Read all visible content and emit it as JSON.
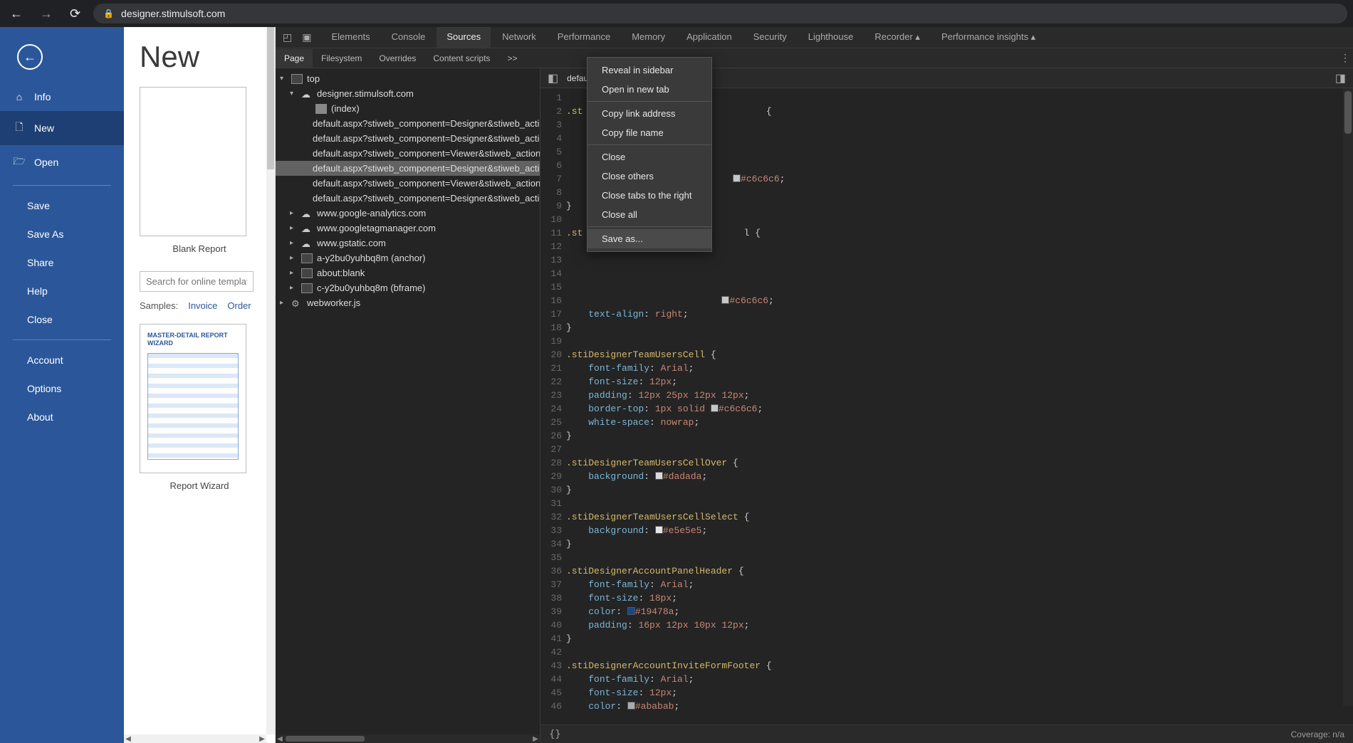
{
  "browser": {
    "url": "designer.stimulsoft.com"
  },
  "app_sidebar": {
    "items": [
      {
        "icon": "ⓘ",
        "label": "Info"
      },
      {
        "icon": "🗋",
        "label": "New"
      },
      {
        "icon": "🗁",
        "label": "Open"
      }
    ],
    "sub1": [
      "Save",
      "Save As",
      "Share",
      "Help",
      "Close"
    ],
    "sub2": [
      "Account",
      "Options",
      "About"
    ]
  },
  "app_content": {
    "title": "New",
    "blank": "Blank Report",
    "search_placeholder": "Search for online templates",
    "samples_label": "Samples:",
    "sample_links": [
      "Invoice",
      "Order"
    ],
    "wizard_title": "MASTER-DETAIL REPORT WIZARD",
    "wizard_label": "Report Wizard"
  },
  "devtools": {
    "top_tabs": [
      "Elements",
      "Console",
      "Sources",
      "Network",
      "Performance",
      "Memory",
      "Application",
      "Security",
      "Lighthouse",
      "Recorder ▴",
      "Performance insights ▴"
    ],
    "top_active": "Sources",
    "sub_tabs": [
      "Page",
      "Filesystem",
      "Overrides",
      "Content scripts",
      ">>"
    ],
    "sub_active": "Page",
    "tree": [
      {
        "indent": 0,
        "toggle": "▾",
        "icon": "frame",
        "label": "top"
      },
      {
        "indent": 1,
        "toggle": "▾",
        "icon": "cloud",
        "label": "designer.stimulsoft.com"
      },
      {
        "indent": 2,
        "toggle": "",
        "icon": "doc",
        "label": "(index)"
      },
      {
        "indent": 2,
        "toggle": "",
        "icon": "yellow",
        "label": "default.aspx?stiweb_component=Designer&stiweb_action=..."
      },
      {
        "indent": 2,
        "toggle": "",
        "icon": "yellow",
        "label": "default.aspx?stiweb_component=Designer&stiweb_action=..."
      },
      {
        "indent": 2,
        "toggle": "",
        "icon": "yellow",
        "label": "default.aspx?stiweb_component=Viewer&stiweb_action=..."
      },
      {
        "indent": 2,
        "toggle": "",
        "icon": "purple",
        "label": "default.aspx?stiweb_component=Designer&stiweb_action=...",
        "hl": true
      },
      {
        "indent": 2,
        "toggle": "",
        "icon": "purple",
        "label": "default.aspx?stiweb_component=Viewer&stiweb_action=..."
      },
      {
        "indent": 2,
        "toggle": "",
        "icon": "green",
        "label": "default.aspx?stiweb_component=Designer&stiweb_action=..."
      },
      {
        "indent": 1,
        "toggle": "▸",
        "icon": "cloud",
        "label": "www.google-analytics.com"
      },
      {
        "indent": 1,
        "toggle": "▸",
        "icon": "cloud",
        "label": "www.googletagmanager.com"
      },
      {
        "indent": 1,
        "toggle": "▸",
        "icon": "cloud",
        "label": "www.gstatic.com"
      },
      {
        "indent": 1,
        "toggle": "▸",
        "icon": "frame",
        "label": "a-y2bu0yuhbq8m (anchor)"
      },
      {
        "indent": 1,
        "toggle": "▸",
        "icon": "frame",
        "label": "about:blank"
      },
      {
        "indent": 1,
        "toggle": "▸",
        "icon": "frame",
        "label": "c-y2bu0yuhbq8m (bframe)"
      },
      {
        "indent": 0,
        "toggle": "▸",
        "icon": "gear",
        "label": "webworker.js"
      }
    ],
    "editor_tab": "defau...",
    "coverage": "Coverage: n/a",
    "status_braces": "{}"
  },
  "code_lines": [
    {
      "n": 1,
      "raw": ""
    },
    {
      "n": 2,
      "raw": ".st                                 {",
      "cutoff": true
    },
    {
      "n": 3,
      "raw": ""
    },
    {
      "n": 4,
      "raw": ""
    },
    {
      "n": 5,
      "raw": ""
    },
    {
      "n": 6,
      "raw": ""
    },
    {
      "n": 7,
      "raw": "                              #c6c6c6;",
      "swatch": "#c6c6c6"
    },
    {
      "n": 8,
      "raw": ""
    },
    {
      "n": 9,
      "raw": "}"
    },
    {
      "n": 10,
      "raw": ""
    },
    {
      "n": 11,
      "raw": ".st                             l {",
      "cutoff": true
    },
    {
      "n": 12,
      "raw": ""
    },
    {
      "n": 13,
      "raw": ""
    },
    {
      "n": 14,
      "raw": ""
    },
    {
      "n": 15,
      "raw": ""
    },
    {
      "n": 16,
      "raw": "                            #c6c6c6;",
      "swatch": "#c6c6c6"
    },
    {
      "n": 17,
      "raw": "    text-align: right;",
      "hidden": true
    },
    {
      "n": 18,
      "raw": "}"
    },
    {
      "n": 19,
      "raw": ""
    },
    {
      "n": 20,
      "raw": ".stiDesignerTeamUsersCell {"
    },
    {
      "n": 21,
      "raw": "    font-family: Arial;"
    },
    {
      "n": 22,
      "raw": "    font-size: 12px;"
    },
    {
      "n": 23,
      "raw": "    padding: 12px 25px 12px 12px;"
    },
    {
      "n": 24,
      "raw": "    border-top: 1px solid #c6c6c6;",
      "swatch": "#c6c6c6"
    },
    {
      "n": 25,
      "raw": "    white-space: nowrap;"
    },
    {
      "n": 26,
      "raw": "}"
    },
    {
      "n": 27,
      "raw": ""
    },
    {
      "n": 28,
      "raw": ".stiDesignerTeamUsersCellOver {"
    },
    {
      "n": 29,
      "raw": "    background: #dadada;",
      "swatch": "#dadada"
    },
    {
      "n": 30,
      "raw": "}"
    },
    {
      "n": 31,
      "raw": ""
    },
    {
      "n": 32,
      "raw": ".stiDesignerTeamUsersCellSelect {"
    },
    {
      "n": 33,
      "raw": "    background: #e5e5e5;",
      "swatch": "#e5e5e5"
    },
    {
      "n": 34,
      "raw": "}"
    },
    {
      "n": 35,
      "raw": ""
    },
    {
      "n": 36,
      "raw": ".stiDesignerAccountPanelHeader {"
    },
    {
      "n": 37,
      "raw": "    font-family: Arial;"
    },
    {
      "n": 38,
      "raw": "    font-size: 18px;"
    },
    {
      "n": 39,
      "raw": "    color: #19478a;",
      "swatch": "#19478a"
    },
    {
      "n": 40,
      "raw": "    padding: 16px 12px 10px 12px;"
    },
    {
      "n": 41,
      "raw": "}"
    },
    {
      "n": 42,
      "raw": ""
    },
    {
      "n": 43,
      "raw": ".stiDesignerAccountInviteFormFooter {"
    },
    {
      "n": 44,
      "raw": "    font-family: Arial;"
    },
    {
      "n": 45,
      "raw": "    font-size: 12px;"
    },
    {
      "n": 46,
      "raw": "    color: #ababab;",
      "swatch": "#ababab"
    }
  ],
  "context_menu": {
    "groups": [
      [
        "Reveal in sidebar",
        "Open in new tab"
      ],
      [
        "Copy link address",
        "Copy file name"
      ],
      [
        "Close",
        "Close others",
        "Close tabs to the right",
        "Close all"
      ],
      [
        "Save as..."
      ]
    ],
    "hovered": "Save as..."
  }
}
